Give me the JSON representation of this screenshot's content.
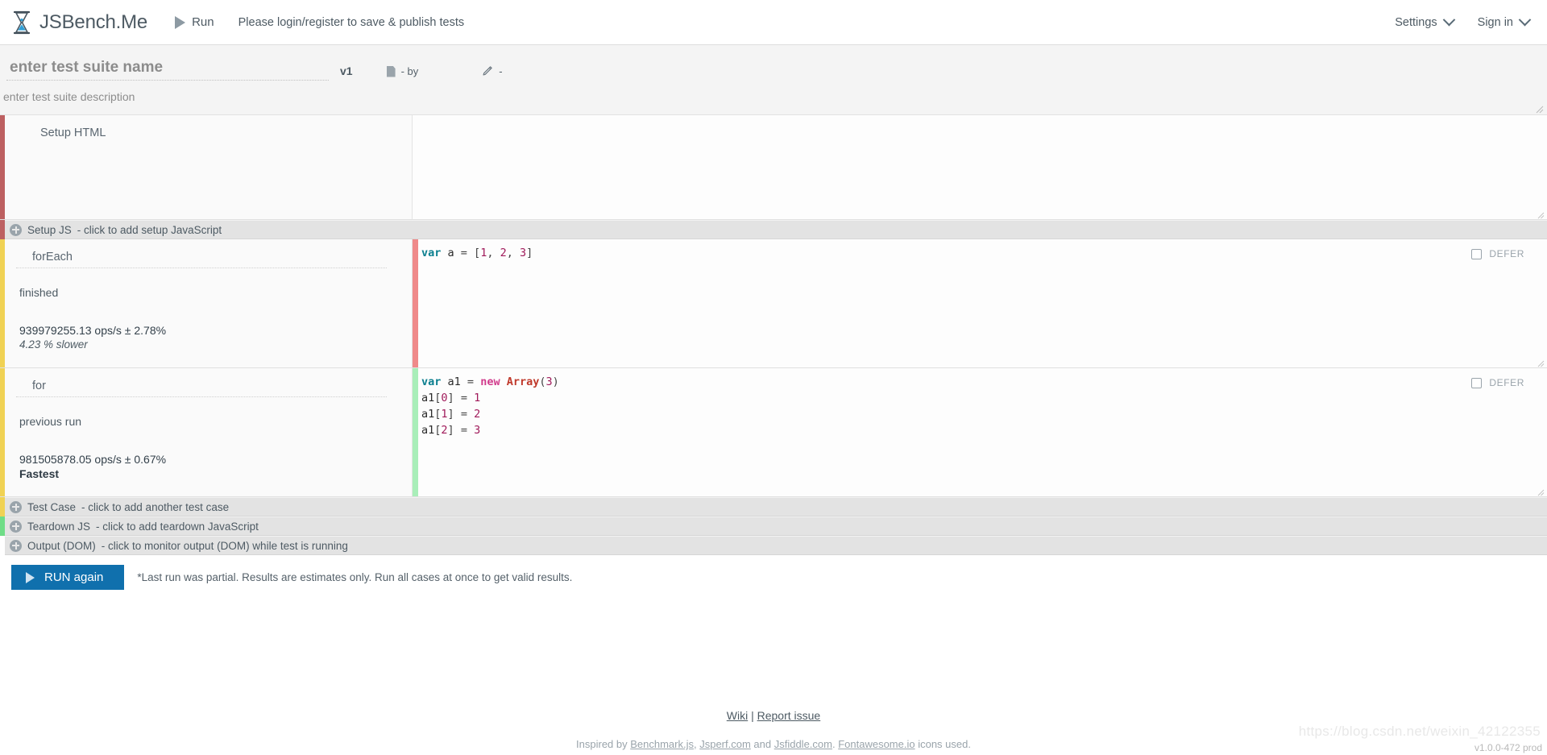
{
  "navbar": {
    "brand": "JSBench.Me",
    "logo_icon": "hourglass-icon",
    "run_label": "Run",
    "run_icon": "play-triangle-icon",
    "login_message": "Please login/register to save & publish tests",
    "settings_label": "Settings",
    "signin_label": "Sign in",
    "caret_icon": "chevron-down-icon"
  },
  "suite": {
    "name_placeholder": "enter test suite name",
    "version": "v1",
    "doc_icon": "document-icon",
    "by_label": "- by",
    "pencil_icon": "pencil-icon",
    "edited_label": "-",
    "description_placeholder": "enter test suite description",
    "resize_icon": "resize-grip-icon"
  },
  "setup_html": {
    "label": "Setup HTML",
    "accent": "#bd6061",
    "code": ""
  },
  "setup_js": {
    "label": "Setup JS",
    "hint": "- click to add setup JavaScript",
    "accent": "#bd6061",
    "plus_icon": "plus-circle-icon"
  },
  "test_cases": [
    {
      "title": "forEach",
      "status": "finished",
      "result": "939979255.13 ops/s ± 2.78%",
      "sub": "4.23 % slower",
      "sub_kind": "slower",
      "accent": "#f0d254",
      "editor_accent": "#ef8a8a",
      "defer_label": "DEFER",
      "defer_checked": false,
      "code_lines": [
        [
          {
            "t": "var",
            "c": "kw"
          },
          {
            "t": " a ",
            "c": ""
          },
          {
            "t": "=",
            "c": "brk"
          },
          {
            "t": " [",
            "c": "brk"
          },
          {
            "t": "1",
            "c": "num"
          },
          {
            "t": ", ",
            "c": "brk"
          },
          {
            "t": "2",
            "c": "num"
          },
          {
            "t": ", ",
            "c": "brk"
          },
          {
            "t": "3",
            "c": "num"
          },
          {
            "t": "]",
            "c": "brk"
          }
        ]
      ]
    },
    {
      "title": "for",
      "status": "previous run",
      "result": "981505878.05 ops/s ± 0.67%",
      "sub": "Fastest",
      "sub_kind": "fastest",
      "accent": "#f0d254",
      "editor_accent": "#a9eeb9",
      "defer_label": "DEFER",
      "defer_checked": false,
      "code_lines": [
        [
          {
            "t": "var",
            "c": "kw"
          },
          {
            "t": " a1 ",
            "c": ""
          },
          {
            "t": "=",
            "c": "brk"
          },
          {
            "t": " ",
            "c": ""
          },
          {
            "t": "new",
            "c": "kw2"
          },
          {
            "t": " ",
            "c": ""
          },
          {
            "t": "Array",
            "c": "cls"
          },
          {
            "t": "(",
            "c": "brk"
          },
          {
            "t": "3",
            "c": "num"
          },
          {
            "t": ")",
            "c": "brk"
          }
        ],
        [
          {
            "t": "a1",
            "c": ""
          },
          {
            "t": "[",
            "c": "brk"
          },
          {
            "t": "0",
            "c": "num"
          },
          {
            "t": "]",
            "c": "brk"
          },
          {
            "t": " = ",
            "c": "brk"
          },
          {
            "t": "1",
            "c": "num"
          }
        ],
        [
          {
            "t": "a1",
            "c": ""
          },
          {
            "t": "[",
            "c": "brk"
          },
          {
            "t": "1",
            "c": "num"
          },
          {
            "t": "]",
            "c": "brk"
          },
          {
            "t": " = ",
            "c": "brk"
          },
          {
            "t": "2",
            "c": "num"
          }
        ],
        [
          {
            "t": "a1",
            "c": ""
          },
          {
            "t": "[",
            "c": "brk"
          },
          {
            "t": "2",
            "c": "num"
          },
          {
            "t": "]",
            "c": "brk"
          },
          {
            "t": " = ",
            "c": "brk"
          },
          {
            "t": "3",
            "c": "num"
          }
        ]
      ]
    }
  ],
  "add_rows": [
    {
      "label": "Test Case",
      "hint": "- click to add another test case",
      "accent": "#f0d254"
    },
    {
      "label": "Teardown JS",
      "hint": "- click to add teardown JavaScript",
      "accent": "#6fdd87"
    },
    {
      "label": "Output (DOM)",
      "hint": "- click to monitor output (DOM) while test is running",
      "accent": "#ffffff"
    }
  ],
  "run": {
    "button_label": "RUN again",
    "button_icon": "play-triangle-icon",
    "button_color": "#1070ad",
    "note": "*Last run was partial. Results are estimates only. Run all cases at once to get valid results."
  },
  "footer": {
    "wiki": "Wiki",
    "separator": "|",
    "report_issue": "Report issue",
    "credit_prefix": "Inspired by ",
    "credit_link1": "Benchmark.js",
    "credit_sep1": ", ",
    "credit_link2": "Jsperf.com",
    "credit_sep2": " and ",
    "credit_link3": "Jsfiddle.com",
    "credit_sep3": ". ",
    "credit_link4": "Fontawesome.io",
    "credit_suffix": " icons used.",
    "watermark": "https://blog.csdn.net/weixin_42122355",
    "version": "v1.0.0-472 prod"
  }
}
